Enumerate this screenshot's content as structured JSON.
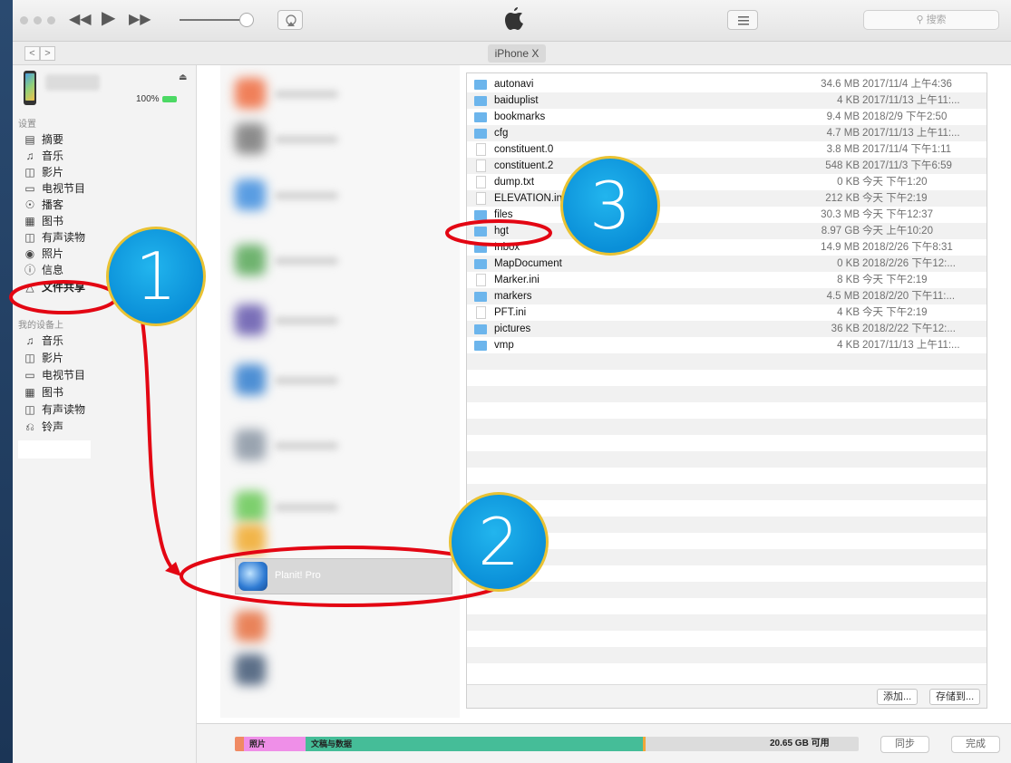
{
  "toolbar": {
    "search_placeholder": "搜索",
    "icons": [
      "close-dot",
      "minimize-dot",
      "zoom-dot",
      "rewind-icon",
      "play-icon",
      "fast-forward-icon",
      "airplay-icon",
      "apple-logo",
      "list-view-icon",
      "search-icon"
    ]
  },
  "navbar": {
    "back": "<",
    "forward": ">",
    "device_tab": "iPhone X"
  },
  "sidebar": {
    "battery": "100%",
    "settings_header": "设置",
    "settings_items": [
      {
        "label": "摘要",
        "icon": "summary-icon"
      },
      {
        "label": "音乐",
        "icon": "music-icon"
      },
      {
        "label": "影片",
        "icon": "film-icon"
      },
      {
        "label": "电视节目",
        "icon": "tv-icon"
      },
      {
        "label": "播客",
        "icon": "podcast-icon"
      },
      {
        "label": "图书",
        "icon": "book-icon"
      },
      {
        "label": "有声读物",
        "icon": "audiobook-icon"
      },
      {
        "label": "照片",
        "icon": "camera-icon"
      },
      {
        "label": "信息",
        "icon": "info-icon"
      },
      {
        "label": "文件共享",
        "icon": "file-sharing-icon"
      }
    ],
    "device_header": "我的设备上",
    "device_items": [
      {
        "label": "音乐",
        "icon": "music-icon"
      },
      {
        "label": "影片",
        "icon": "film-icon"
      },
      {
        "label": "电视节目",
        "icon": "tv-icon"
      },
      {
        "label": "图书",
        "icon": "book-icon"
      },
      {
        "label": "有声读物",
        "icon": "audiobook-icon"
      },
      {
        "label": "铃声",
        "icon": "bell-icon"
      }
    ]
  },
  "apps": {
    "selected_app": "Planit! Pro"
  },
  "files": [
    {
      "name": "autonavi",
      "type": "folder",
      "size": "34.6 MB",
      "date": "2017/11/4 上午4:36"
    },
    {
      "name": "baiduplist",
      "type": "folder",
      "size": "4 KB",
      "date": "2017/11/13 上午11:..."
    },
    {
      "name": "bookmarks",
      "type": "folder",
      "size": "9.4 MB",
      "date": "2018/2/9 下午2:50"
    },
    {
      "name": "cfg",
      "type": "folder",
      "size": "4.7 MB",
      "date": "2017/11/13 上午11:..."
    },
    {
      "name": "constituent.0",
      "type": "file",
      "size": "3.8 MB",
      "date": "2017/11/4 下午1:11"
    },
    {
      "name": "constituent.2",
      "type": "file",
      "size": "548 KB",
      "date": "2017/11/3 下午6:59"
    },
    {
      "name": "dump.txt",
      "type": "file",
      "size": "0 KB",
      "date": "今天 下午1:20"
    },
    {
      "name": "ELEVATION.ini",
      "type": "file",
      "size": "212 KB",
      "date": "今天 下午2:19"
    },
    {
      "name": "files",
      "type": "folder",
      "size": "30.3 MB",
      "date": "今天 下午12:37"
    },
    {
      "name": "hgt",
      "type": "folder",
      "size": "8.97 GB",
      "date": "今天 上午10:20"
    },
    {
      "name": "Inbox",
      "type": "folder",
      "size": "14.9 MB",
      "date": "2018/2/26 下午8:31"
    },
    {
      "name": "MapDocument",
      "type": "folder",
      "size": "0 KB",
      "date": "2018/2/26 下午12:..."
    },
    {
      "name": "Marker.ini",
      "type": "file",
      "size": "8 KB",
      "date": "今天 下午2:19"
    },
    {
      "name": "markers",
      "type": "folder",
      "size": "4.5 MB",
      "date": "2018/2/20 下午11:..."
    },
    {
      "name": "PFT.ini",
      "type": "file",
      "size": "4 KB",
      "date": "今天 下午2:19"
    },
    {
      "name": "pictures",
      "type": "folder",
      "size": "36 KB",
      "date": "2018/2/22 下午12:..."
    },
    {
      "name": "vmp",
      "type": "folder",
      "size": "4 KB",
      "date": "2017/11/13 上午11:..."
    }
  ],
  "file_panel": {
    "add_button": "添加...",
    "save_button": "存储到..."
  },
  "storage": {
    "photos_label": "照片",
    "docs_label": "文稿与数据",
    "free_label": "20.65 GB 可用",
    "colors": {
      "photos": "#ef8fe8",
      "docs": "#45bd98",
      "other": "#f0a73a",
      "apps": "#f08a63"
    }
  },
  "bottom_buttons": {
    "sync": "同步",
    "done": "完成"
  },
  "annotations": {
    "step1": "1",
    "step2": "2",
    "step3": "3",
    "accent": "#e30613"
  }
}
